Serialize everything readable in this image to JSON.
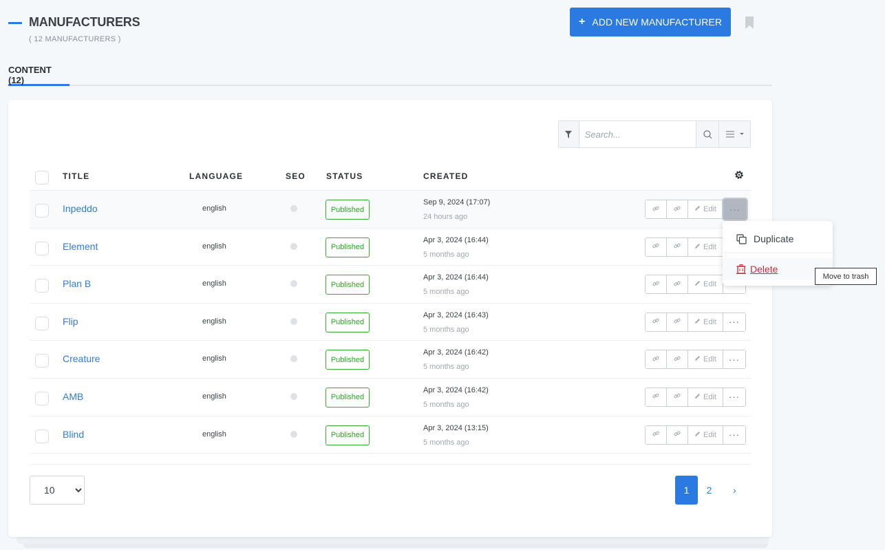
{
  "header": {
    "title": "MANUFACTURERS",
    "subtitle": "( 12 MANUFACTURERS )",
    "add_button_label": "ADD NEW MANUFACTURER",
    "add_button_icon": "plus-icon",
    "bookmark_icon": "bookmark-icon"
  },
  "tabs": [
    {
      "label": "CONTENT (12)",
      "active": true
    }
  ],
  "toolbar": {
    "filter_icon": "filter-icon",
    "search_placeholder": "Search...",
    "search_value": "",
    "search_icon": "search-icon",
    "view_icon": "list-view-icon"
  },
  "table": {
    "columns": {
      "title": "TITLE",
      "language": "LANGUAGE",
      "seo": "SEO",
      "status": "STATUS",
      "created": "CREATED"
    },
    "settings_icon": "gear-icon",
    "edit_label": "Edit",
    "rows": [
      {
        "title": "Inpeddo",
        "language": "english",
        "status": "Published",
        "created": "Sep 9, 2024 (17:07)",
        "ago": "24 hours ago"
      },
      {
        "title": "Element",
        "language": "english",
        "status": "Published",
        "created": "Apr 3, 2024 (16:44)",
        "ago": "5 months ago"
      },
      {
        "title": "Plan B",
        "language": "english",
        "status": "Published",
        "created": "Apr 3, 2024 (16:44)",
        "ago": "5 months ago"
      },
      {
        "title": "Flip",
        "language": "english",
        "status": "Published",
        "created": "Apr 3, 2024 (16:43)",
        "ago": "5 months ago"
      },
      {
        "title": "Creature",
        "language": "english",
        "status": "Published",
        "created": "Apr 3, 2024 (16:42)",
        "ago": "5 months ago"
      },
      {
        "title": "AMB",
        "language": "english",
        "status": "Published",
        "created": "Apr 3, 2024 (16:42)",
        "ago": "5 months ago"
      },
      {
        "title": "Blind",
        "language": "english",
        "status": "Published",
        "created": "Apr 3, 2024 (13:15)",
        "ago": "5 months ago"
      }
    ]
  },
  "dropdown": {
    "duplicate_label": "Duplicate",
    "delete_label": "Delete",
    "tooltip": "Move to trash"
  },
  "footer": {
    "per_page": "10",
    "pages": [
      "1",
      "2"
    ],
    "current_page": "1",
    "next_label": "›"
  },
  "colors": {
    "accent": "#2a7ae2",
    "status_published": "#2aa721",
    "danger": "#c72c3a"
  }
}
